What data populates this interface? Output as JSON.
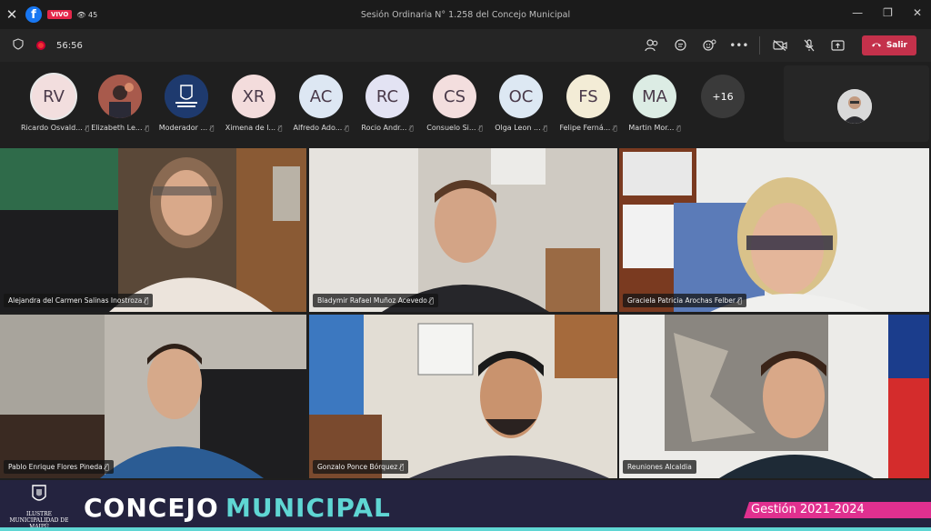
{
  "window": {
    "title": "Sesión Ordinaria N° 1.258 del Concejo Municipal",
    "live_label": "VIVO",
    "viewers": "45",
    "app_icon": "facebook-icon"
  },
  "toolbar": {
    "timer": "56:56",
    "leave_label": "Salir"
  },
  "participants": [
    {
      "initials": "RV",
      "name": "Ricardo Osvald...",
      "bg": "#f2dede"
    },
    {
      "initials": "",
      "name": "Elizabeth Le...",
      "bg": "#6b3c3c"
    },
    {
      "initials": "",
      "name": "Moderador ...",
      "bg": "#1e3a6e"
    },
    {
      "initials": "XR",
      "name": "Ximena de l...",
      "bg": "#f3dcdc"
    },
    {
      "initials": "AC",
      "name": "Alfredo Ado...",
      "bg": "#dde7f3"
    },
    {
      "initials": "RC",
      "name": "Rocio Andr...",
      "bg": "#e3e3f3"
    },
    {
      "initials": "CS",
      "name": "Consuelo Si...",
      "bg": "#f3dede"
    },
    {
      "initials": "OC",
      "name": "Olga Leon ...",
      "bg": "#dde8f3"
    },
    {
      "initials": "FS",
      "name": "Felipe Ferná...",
      "bg": "#f3ecd6"
    },
    {
      "initials": "MA",
      "name": "Martin Mor...",
      "bg": "#dcece4"
    }
  ],
  "more_count": "+16",
  "tiles": [
    {
      "name": "Alejandra del Carmen Salinas Inostroza",
      "color": "#6b5a4a"
    },
    {
      "name": "Bladymir Rafael Muñoz Acevedo",
      "color": "#c9c4bc"
    },
    {
      "name": "Graciela Patricia Arochas Felber",
      "color": "#e4e4e4"
    },
    {
      "name": "Pablo Enrique Flores Pineda",
      "color": "#b7b2aa"
    },
    {
      "name": "Gonzalo Ponce Bórquez",
      "color": "#d6d0c6"
    },
    {
      "name": "Reuniones Alcaldia",
      "color": "#e8e8e6"
    }
  ],
  "banner": {
    "logo_lines": [
      "ILUSTRE",
      "MUNICIPALIDAD DE",
      "MAIPÚ"
    ],
    "title_part1": "CONCEJO",
    "title_part2": "MUNICIPAL",
    "period": "Gestión 2021-2024",
    "accent": "#5fd6d3",
    "pink": "#e0308f"
  }
}
